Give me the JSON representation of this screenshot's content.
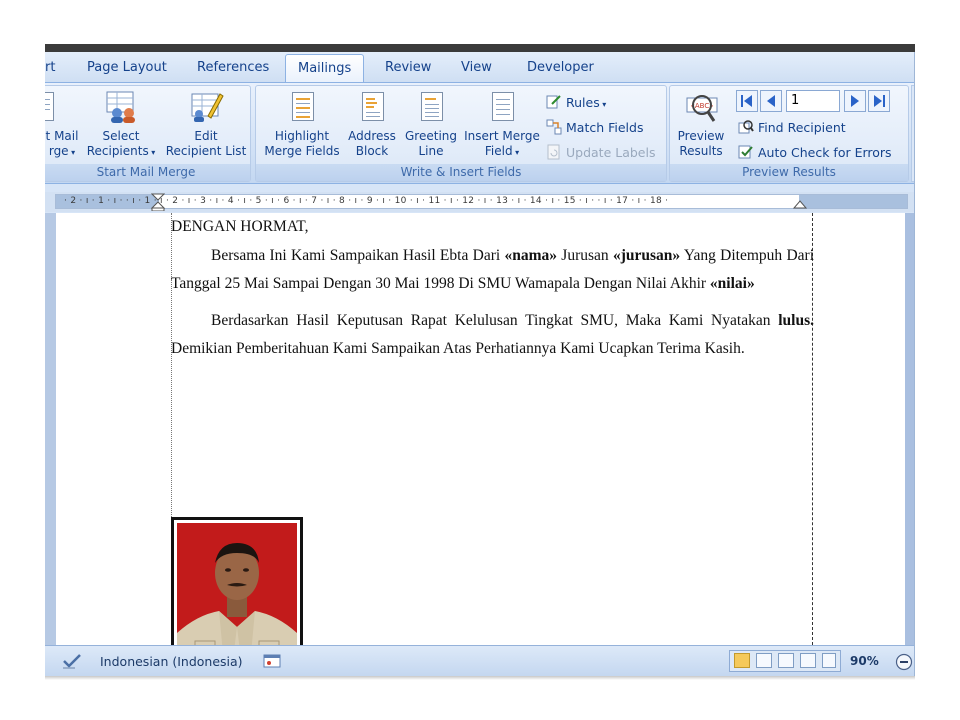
{
  "tabs": [
    {
      "label": "rt"
    },
    {
      "label": "Page Layout"
    },
    {
      "label": "References"
    },
    {
      "label": "Mailings"
    },
    {
      "label": "Review"
    },
    {
      "label": "View"
    },
    {
      "label": "Developer"
    }
  ],
  "active_tab": "Mailings",
  "groups": {
    "start_mail_merge": {
      "label": "Start Mail Merge",
      "start_line1": "t Mail",
      "start_line2": "rge",
      "select_line1": "Select",
      "select_line2": "Recipients",
      "edit_line1": "Edit",
      "edit_line2": "Recipient List"
    },
    "write_insert": {
      "label": "Write & Insert Fields",
      "highlight_line1": "Highlight",
      "highlight_line2": "Merge Fields",
      "address_line1": "Address",
      "address_line2": "Block",
      "greeting_line1": "Greeting",
      "greeting_line2": "Line",
      "insert_line1": "Insert Merge",
      "insert_line2": "Field",
      "rules": "Rules",
      "match_fields": "Match Fields",
      "update_labels": "Update Labels"
    },
    "preview_results": {
      "label": "Preview Results",
      "preview_line1": "Preview",
      "preview_line2": "Results",
      "record_number": "1",
      "find_recipient": "Find Recipient",
      "auto_check": "Auto Check for Errors"
    }
  },
  "ruler": {
    "text": "· 2 · ı · 1 · ı ·   · ı · 1 · ı · 2 · ı · 3 · ı · 4 · ı · 5 · ı · 6 · ı · 7 · ı · 8 · ı · 9 · ı · 10 · ı · 11 · ı · 12 · ı · 13 · ı · 14 · ı · 15 · ı ·   · ı · 17 · ı · 18 ·"
  },
  "document": {
    "salutation": "DENGAN HORMAT,",
    "p1_a": "Bersama Ini Kami Sampaikan Hasil Ebta Dari ",
    "p1_field1": "«nama»",
    "p1_b": " Jurusan ",
    "p1_field2": "«jurusan»",
    "p1_c": " Yang Ditempuh Dari Tanggal 25 Mai Sampai Dengan 30 Mai 1998 Di SMU Wamapala Dengan Nilai Akhir ",
    "p1_field3": "«nilai»",
    "p2_a": "Berdasarkan Hasil Keputusan Rapat Kelulusan Tingkat SMU, Maka  Kami Nyatakan ",
    "p2_bold": "lulus.",
    "p2_b": " Demikian Pemberitahuan Kami Sampaikan Atas Perhatiannya Kami  Ucapkan Terima Kasih."
  },
  "status": {
    "language": "Indonesian (Indonesia)",
    "zoom": "90%"
  },
  "colors": {
    "ribbon_text": "#15428b",
    "ribbon_bg": "#d7e5f7",
    "photo_bg": "#c21b1b"
  }
}
